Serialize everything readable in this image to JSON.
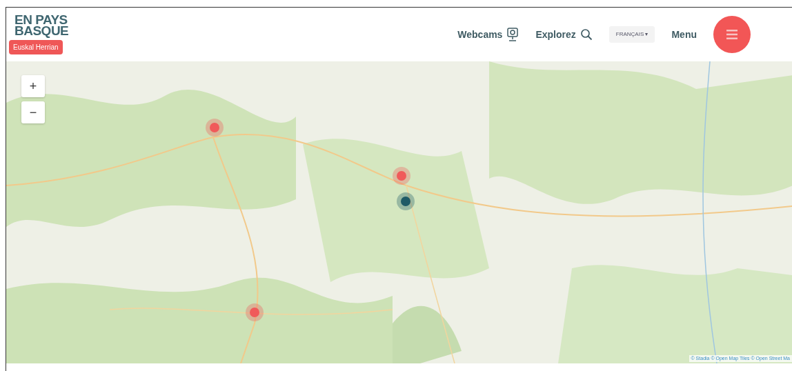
{
  "header": {
    "logo_lines": [
      "EN PAYS",
      "BASQUE"
    ],
    "logo_badge": "Euskal Herrian",
    "nav": [
      {
        "label": "Webcams",
        "kind": "webcam"
      },
      {
        "label": "Explorez",
        "kind": "search"
      }
    ],
    "language": {
      "label": "FRANÇAIS",
      "caret": "▾"
    },
    "menu_label": "Menu"
  },
  "map": {
    "zoom_controls": [
      "+",
      "−"
    ],
    "markers": [
      {
        "color": "#f05a5a"
      },
      {
        "color": "#f05a5a"
      },
      {
        "color": "#1f5a66"
      },
      {
        "color": "#f05a5a"
      }
    ],
    "attribution": "© Stadia © Open Map Tiles © Open Street Ma"
  }
}
